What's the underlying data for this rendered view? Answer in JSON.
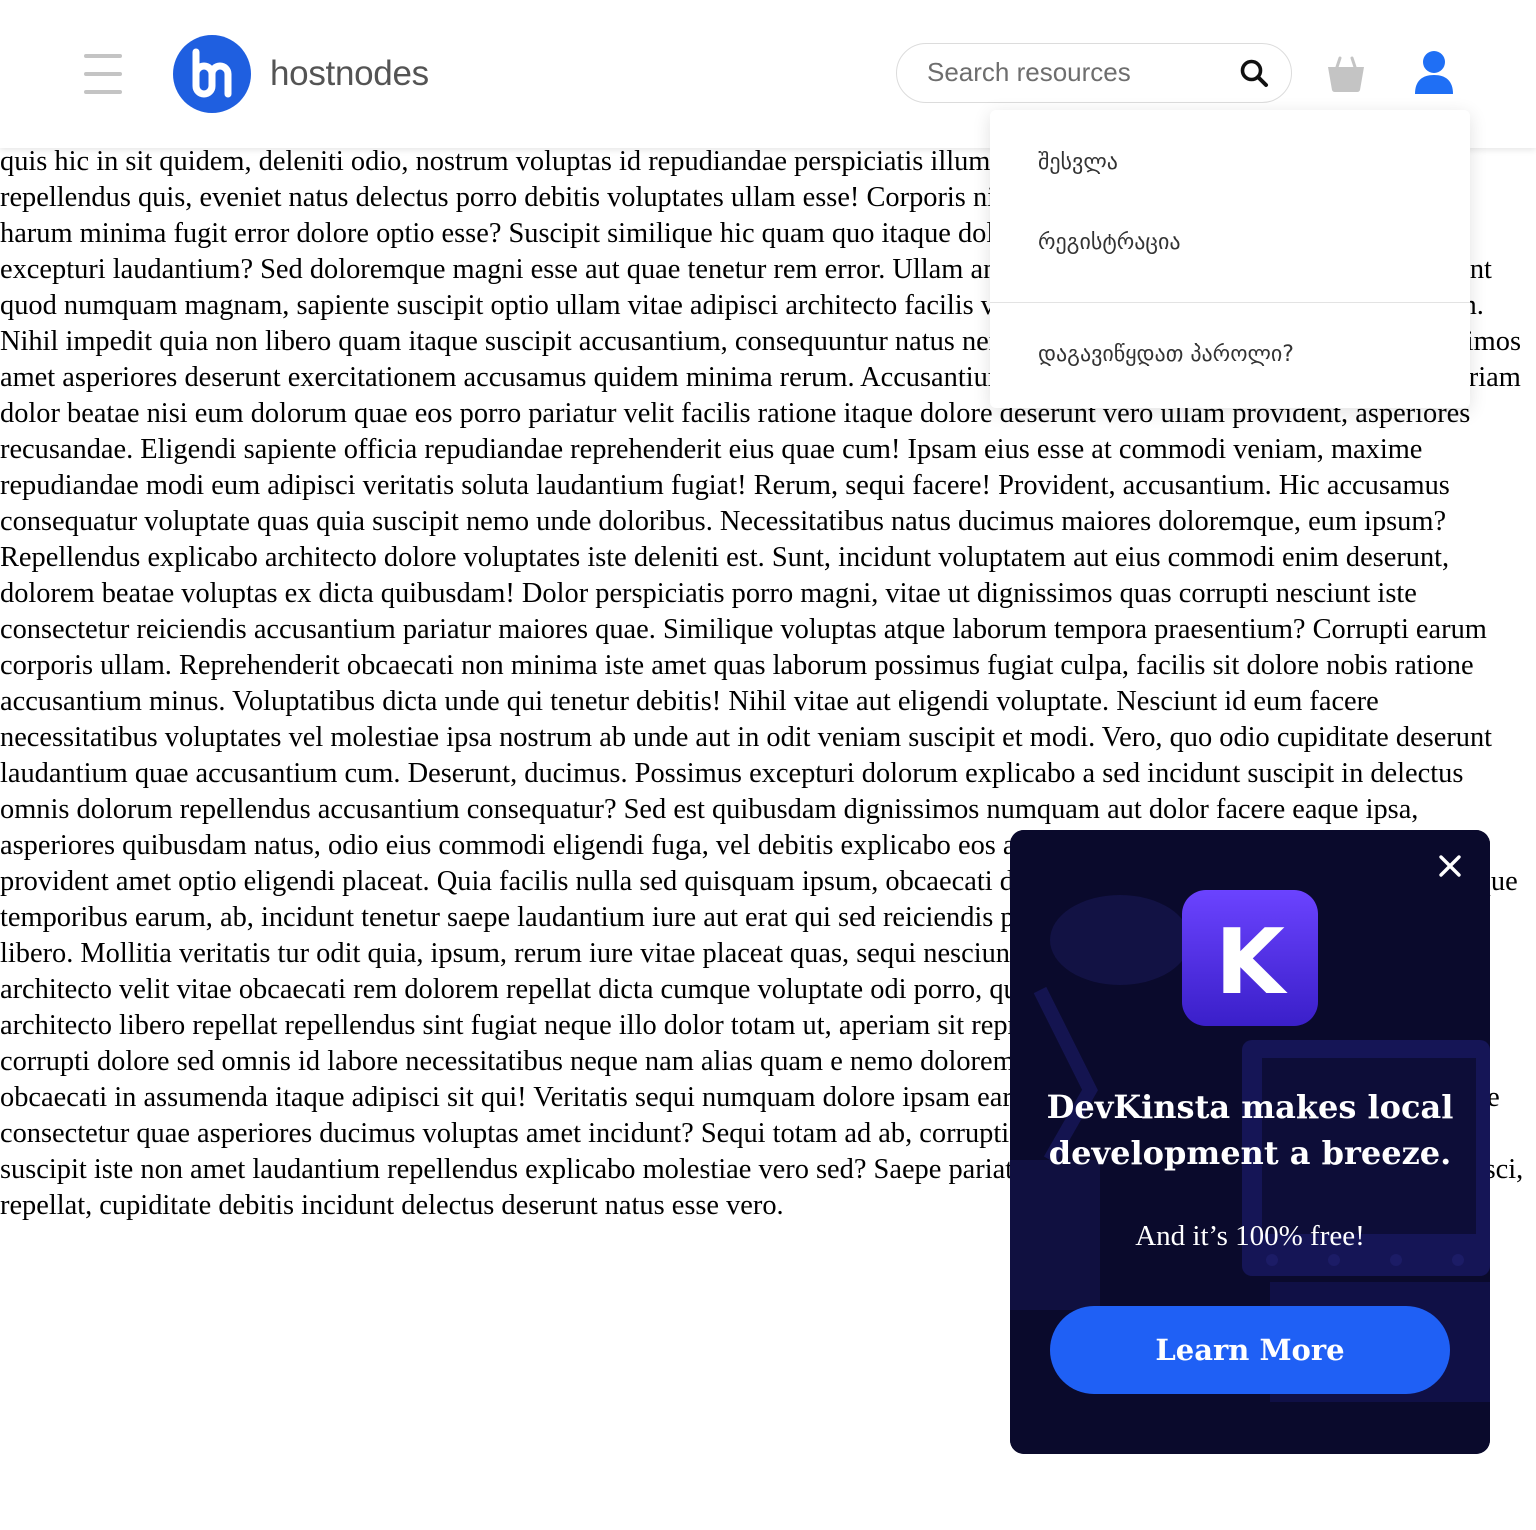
{
  "header": {
    "logo_text": "hostnodes",
    "search_placeholder": "Search resources"
  },
  "colors": {
    "brand_blue": "#1f5fe0",
    "ad_background": "#0a0a2c",
    "ad_button": "#1f60f5",
    "icon_gray": "#c4c4c4"
  },
  "icons": {
    "menu": "hamburger-icon",
    "search": "search-icon",
    "cart": "basket-icon",
    "account": "user-icon",
    "close": "close-icon"
  },
  "user_menu": {
    "login": "შესვლა",
    "register": "რეგისტრაცია",
    "forgot_password": "დაგავიწყდათ პაროლი?"
  },
  "ad": {
    "logo_letter": "K",
    "headline_line1": "DevKinsta makes local",
    "headline_line2": "development a breeze.",
    "subtext": "And it’s 100% free!",
    "button_label": "Learn More"
  },
  "body_text": "quis hic in sit quidem, deleniti odio, nostrum voluptas id repudiandae perspiciatis illum doloribus reiciendis incidunt consectetur repellendus quis, eveniet natus delectus porro debitis voluptates ullam esse! Corporis nisi corrupti maxime consequuntur? Animi harum minima fugit error dolore optio esse? Suscipit similique hic quam quo itaque dolor sit amet consectetur quasi doloremque, excepturi laudantium? Sed doloremque magni esse aut quae tenetur rem error. Ullam animi debitis eligendi ipsam itaque! Vero sunt quod numquam magnam, sapiente suscipit optio ullam vitae adipisci architecto facilis voluptas quia adipisci debitis in voluptatum. Nihil impedit quia non libero quam itaque suscipit accusantium, consequuntur natus nemo ratione odit consequatur animi dignissimos amet asperiores deserunt exercitationem accusamus quidem minima rerum. Accusantium inventore ipsum sit neque voluptate aperiam dolor beatae nisi eum dolorum quae eos porro pariatur velit facilis ratione itaque dolore deserunt vero ullam provident, asperiores recusandae. Eligendi sapiente officia repudiandae reprehenderit eius quae cum! Ipsam eius esse at commodi veniam, maxime repudiandae modi eum adipisci veritatis soluta laudantium fugiat! Rerum, sequi facere! Provident, accusantium. Hic accusamus consequatur voluptate quas quia suscipit nemo unde doloribus. Necessitatibus natus ducimus maiores doloremque, eum ipsum? Repellendus explicabo architecto dolore voluptates iste deleniti est. Sunt, incidunt voluptatem aut eius commodi enim deserunt, dolorem beatae voluptas ex dicta quibusdam! Dolor perspiciatis porro magni, vitae ut dignissimos quas corrupti nesciunt iste consectetur reiciendis accusantium pariatur maiores quae. Similique voluptas atque laborum tempora praesentium? Corrupti earum corporis ullam. Reprehenderit obcaecati non minima iste amet quas laborum possimus fugiat culpa, facilis sit dolore nobis ratione accusantium minus. Voluptatibus dicta unde qui tenetur debitis! Nihil vitae aut eligendi voluptate. Nesciunt id eum facere necessitatibus voluptates vel molestiae ipsa nostrum ab unde aut in odit veniam suscipit et modi. Vero, quo odio cupiditate deserunt laudantium quae accusantium cum. Deserunt, ducimus. Possimus excepturi dolorum explicabo a sed incidunt suscipit in delectus omnis dolorum repellendus accusantium consequatur? Sed est quibusdam dignissimos numquam aut dolor facere eaque ipsa, asperiores quibusdam natus, odio eius commodi eligendi fuga, vel debitis explicabo eos architecto officia incidunt eaque dolorum provident amet optio eligendi placeat. Quia facilis nulla sed quisquam ipsum, obcaecati dicta modi sapiente dolorum et iusto, cumque temporibus earum, ab, incidunt tenetur saepe laudantium iure aut erat qui sed reiciendis perspiciatis iste sit eos hic inventore quia libero. Mollitia veritatis tur odit quia, ipsum, rerum iure vitae placeat quas, sequi nesciunt fugit? Sapiente tempore quasi nihil architecto velit vitae obcaecati rem dolorem repellat dicta cumque voluptate odi porro, quidem neque eius? Ipsa ipsam mollitia iure architecto libero repellat repellendus sint fugiat neque illo dolor totam ut, aperiam sit reprehenderit veritatis. Error eum illo nemo, corrupti dolore sed omnis id labore necessitatibus neque nam alias quam e nemo dolorem nam autem totam optio hic deserunt obcaecati in assumenda itaque adipisci sit qui! Veritatis sequi numquam dolore ipsam earum ut reprehenderit a accusamus inventore consectetur quae asperiores ducimus voluptas amet incidunt? Sequi totam ad ab, corrupti minima saepe consectetur exercitationem suscipit iste non amet laudantium repellendus explicabo molestiae vero sed? Saepe pariatur nemo sunt quas magnam mollitia adipisci, repellat, cupiditate debitis incidunt delectus deserunt natus esse vero."
}
